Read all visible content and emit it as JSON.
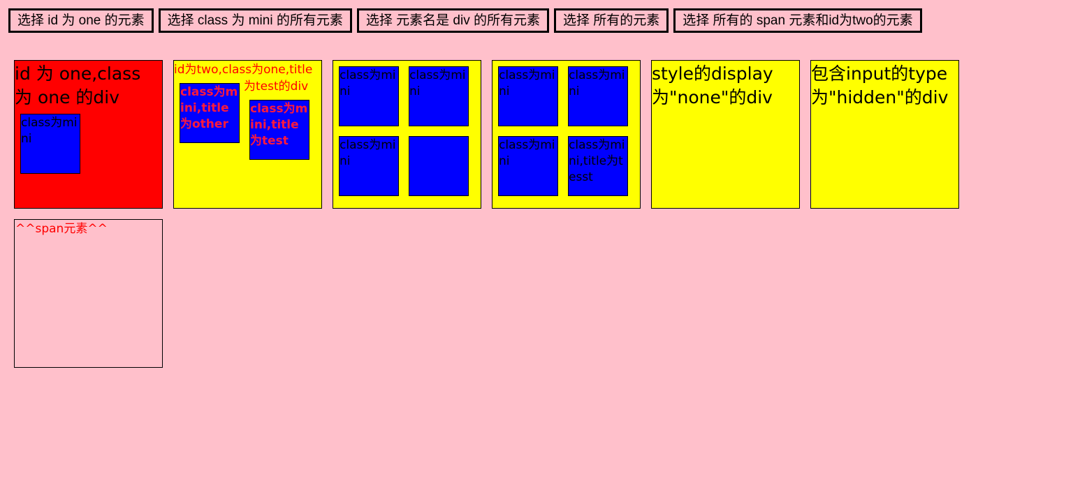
{
  "toolbar": {
    "btn1": "选择 id 为 one 的元素",
    "btn2": "选择 class 为 mini 的所有元素",
    "btn3": "选择 元素名是 div 的所有元素",
    "btn4": "选择 所有的元素",
    "btn5": "选择 所有的 span 元素和id为two的元素"
  },
  "boxes": {
    "one": {
      "label": "id 为 one,class 为 one 的div",
      "mini": "class为mini"
    },
    "two": {
      "label_line1": "id为two,class为one,title",
      "label_line2": "为test的div",
      "mini1": "class为mini,title为other",
      "mini2": "class为mini,title为test"
    },
    "three": {
      "mini1": "class为mini",
      "mini2": "class为mini",
      "mini3": "class为mini",
      "mini4": ""
    },
    "four": {
      "mini1": "class为mini",
      "mini2": "class为mini",
      "mini3": "class为mini",
      "mini4": "class为mini,title为tesst"
    },
    "five": {
      "label": "style的display为\"none\"的div"
    },
    "six": {
      "label": "包含input的type为\"hidden\"的div"
    },
    "span_box": {
      "label": "^^span元素^^"
    }
  },
  "colors": {
    "background": "#ffc0cb",
    "red": "#ff0000",
    "yellow": "#ffff00",
    "blue": "#0000ff"
  }
}
